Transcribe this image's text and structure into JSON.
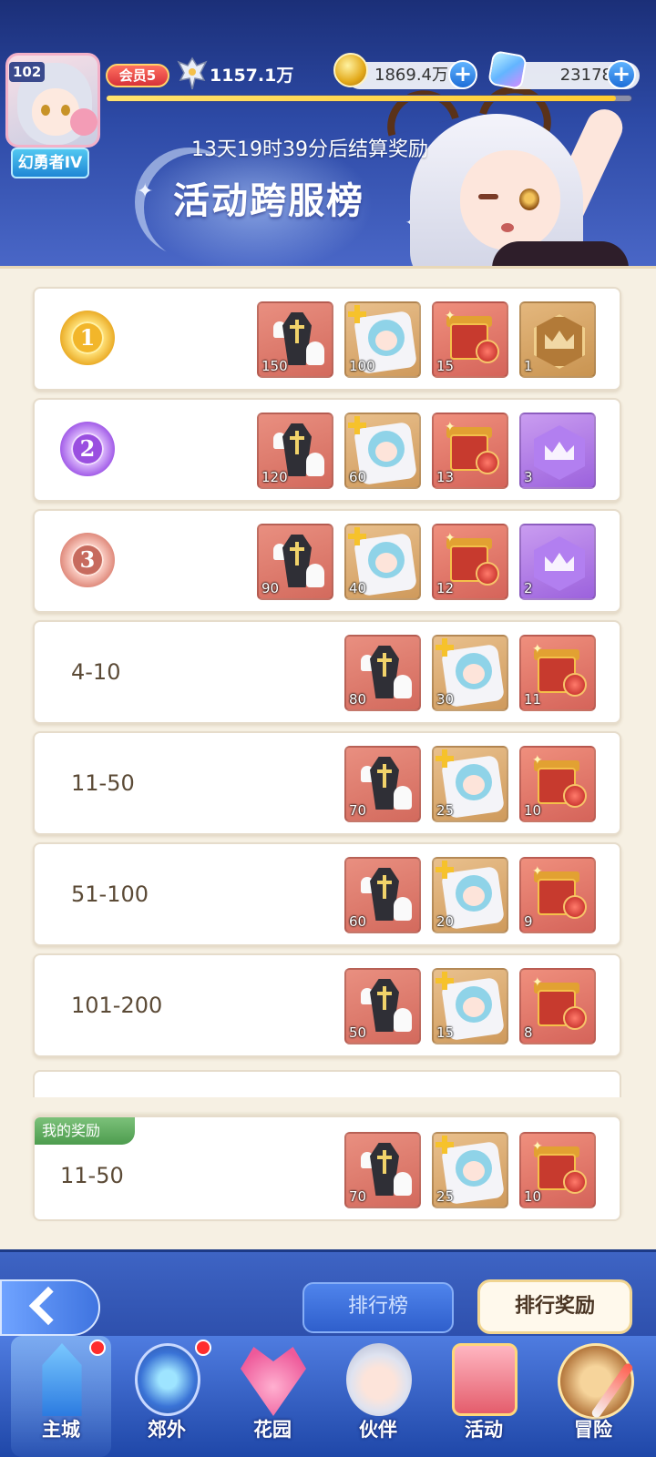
{
  "header": {
    "player": {
      "level": "102",
      "title": "幻勇者IV",
      "vip_label": "会员5",
      "power": "1157.1万",
      "exp_progress": 0.97
    },
    "resources": {
      "gold": "1869.4万",
      "gems": "23178"
    },
    "countdown": "13天19时39分后结算奖励",
    "board_title": "活动跨服榜"
  },
  "ranks": [
    {
      "rank_label": "1",
      "medal": "gold",
      "rewards": [
        {
          "type": "coffin",
          "qty": "150"
        },
        {
          "type": "pillow",
          "qty": "100"
        },
        {
          "type": "gift",
          "qty": "15"
        },
        {
          "type": "crest-gold",
          "qty": "1"
        }
      ]
    },
    {
      "rank_label": "2",
      "medal": "purple",
      "rewards": [
        {
          "type": "coffin",
          "qty": "120"
        },
        {
          "type": "pillow",
          "qty": "60"
        },
        {
          "type": "gift",
          "qty": "13"
        },
        {
          "type": "crest-purple",
          "qty": "3"
        }
      ]
    },
    {
      "rank_label": "3",
      "medal": "bronze",
      "rewards": [
        {
          "type": "coffin",
          "qty": "90"
        },
        {
          "type": "pillow",
          "qty": "40"
        },
        {
          "type": "gift",
          "qty": "12"
        },
        {
          "type": "crest-purple",
          "qty": "2"
        }
      ]
    },
    {
      "rank_label": "4-10",
      "rewards": [
        {
          "type": "coffin",
          "qty": "80"
        },
        {
          "type": "pillow",
          "qty": "30"
        },
        {
          "type": "gift",
          "qty": "11"
        }
      ]
    },
    {
      "rank_label": "11-50",
      "rewards": [
        {
          "type": "coffin",
          "qty": "70"
        },
        {
          "type": "pillow",
          "qty": "25"
        },
        {
          "type": "gift",
          "qty": "10"
        }
      ]
    },
    {
      "rank_label": "51-100",
      "rewards": [
        {
          "type": "coffin",
          "qty": "60"
        },
        {
          "type": "pillow",
          "qty": "20"
        },
        {
          "type": "gift",
          "qty": "9"
        }
      ]
    },
    {
      "rank_label": "101-200",
      "rewards": [
        {
          "type": "coffin",
          "qty": "50"
        },
        {
          "type": "pillow",
          "qty": "15"
        },
        {
          "type": "gift",
          "qty": "8"
        }
      ]
    }
  ],
  "my_reward": {
    "tag": "我的奖励",
    "rank_label": "11-50",
    "rewards": [
      {
        "type": "coffin",
        "qty": "70"
      },
      {
        "type": "pillow",
        "qty": "25"
      },
      {
        "type": "gift",
        "qty": "10"
      }
    ]
  },
  "tabs": {
    "ranking": "排行榜",
    "ranking_rewards": "排行奖励"
  },
  "nav": {
    "items": [
      {
        "id": "city",
        "label": "主城",
        "badge": true
      },
      {
        "id": "suburb",
        "label": "郊外",
        "badge": true
      },
      {
        "id": "garden",
        "label": "花园",
        "badge": false
      },
      {
        "id": "partner",
        "label": "伙伴",
        "badge": false
      },
      {
        "id": "event",
        "label": "活动",
        "badge": false
      },
      {
        "id": "adventure",
        "label": "冒险",
        "badge": false
      }
    ]
  }
}
